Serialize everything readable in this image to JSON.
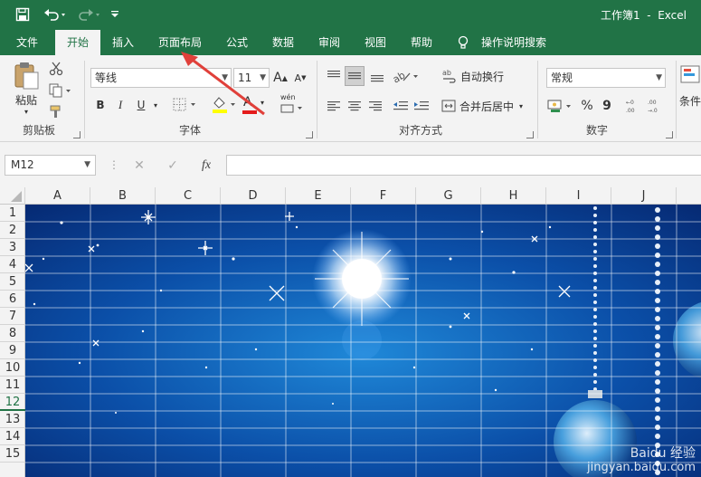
{
  "app": {
    "document": "工作簿1",
    "app_name": "Excel",
    "title_sep": "  -  "
  },
  "tabs": [
    "文件",
    "开始",
    "插入",
    "页面布局",
    "公式",
    "数据",
    "审阅",
    "视图",
    "帮助",
    "操作说明搜索"
  ],
  "active_tab": "开始",
  "ribbon": {
    "clipboard": {
      "paste": "粘贴",
      "label": "剪贴板"
    },
    "font": {
      "family": "等线",
      "size": "11",
      "bold": "B",
      "italic": "I",
      "underline": "U",
      "label": "字体",
      "grow": "A",
      "shrink": "A",
      "font_color_glyph": "A",
      "phonetic": "wén"
    },
    "alignment": {
      "wrap": "自动换行",
      "merge": "合并后居中",
      "label": "对齐方式"
    },
    "number": {
      "format": "常规",
      "percent": "%",
      "comma": "9",
      "label": "数字"
    },
    "styles": {
      "conditional": "条件"
    }
  },
  "formula_bar": {
    "name_box": "M12",
    "fx": "fx",
    "cancel": "✕",
    "enter": "✓",
    "value": ""
  },
  "columns": [
    "A",
    "B",
    "C",
    "D",
    "E",
    "F",
    "G",
    "H",
    "I",
    "J"
  ],
  "rows": [
    "1",
    "2",
    "3",
    "4",
    "5",
    "6",
    "7",
    "8",
    "9",
    "10",
    "11",
    "12",
    "13",
    "14",
    "15"
  ],
  "selected_row": "12",
  "watermark": {
    "line1": "Baidu 经验",
    "line2": "jingyan.baidu.com"
  },
  "colors": {
    "excel_green": "#217346",
    "arrow": "#e0403a",
    "sky": "#0b4fa8"
  }
}
